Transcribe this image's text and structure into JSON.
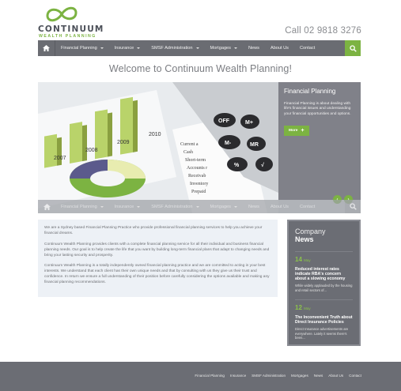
{
  "brand": {
    "name": "CONTINUUM",
    "sub": "WEALTH PLANNING"
  },
  "phone": "Call 02 9818 3276",
  "nav": {
    "items": [
      {
        "label": "Financial Planning",
        "dropdown": true
      },
      {
        "label": "Insurance",
        "dropdown": true
      },
      {
        "label": "SMSF Administration",
        "dropdown": true
      },
      {
        "label": "Mortgages",
        "dropdown": true
      },
      {
        "label": "News",
        "dropdown": false
      },
      {
        "label": "About Us",
        "dropdown": false
      },
      {
        "label": "Contact",
        "dropdown": false
      }
    ]
  },
  "welcome": "Welcome to Continuum Wealth Planning!",
  "hero": {
    "panel_title": "Financial Planning",
    "panel_text": "Financial Planning is about dealing with life's financial issues and understanding your financial opportunities and options.",
    "more_label": "More",
    "image_years": [
      "2007",
      "2008",
      "2009",
      "2010"
    ],
    "calc_keys": [
      "OFF",
      "M+",
      "M-",
      "MR",
      "%",
      "√"
    ],
    "paper_words": [
      "Current a",
      "Cash",
      "Short-term",
      "Accounts r",
      "Receivab",
      "Inventory",
      "Prepaid"
    ]
  },
  "intro": {
    "paragraphs": [
      "We are a Sydney based Financial Planning Practice who provide professional financial planning services to help you achieve your financial dreams.",
      "Continuum Wealth Planning provides clients with a complete financial planning service for all their individual and business financial planning needs. Our goal is to help create the life that you want by building long-term financial plans that adapt to changing needs and bring your lasting security and prosperity.",
      "Continuum Wealth Planning is a totally independently owned financial planning practice and we are committed to acting in your best interests. We understand that each client has their own unique needs and that by consulting with us they give us their trust and confidence. In return we ensure a full understanding of their position before carefully considering the options available and making any financial planning recommendations."
    ]
  },
  "news": {
    "title1": "Company",
    "title2": "News",
    "items": [
      {
        "day": "14",
        "month": "May",
        "headline": "Reduced interest rates indicate RBA's concern about a slowing economy",
        "text": "While widely applauded by the housing and retail sectors of..."
      },
      {
        "day": "12",
        "month": "May",
        "headline": "The Inconvenient Truth about Direct Insurance Policies",
        "text": "Direct Insurance advertisements are everywhere. Lately it seems there's been..."
      }
    ]
  },
  "footer": {
    "links": [
      "Financial Planning",
      "Insurance",
      "SMSF Administration",
      "Mortgages",
      "News",
      "About Us",
      "Contact"
    ]
  },
  "colors": {
    "accent": "#7cb342",
    "nav": "#6a6c72",
    "panel": "#6b6d74"
  }
}
